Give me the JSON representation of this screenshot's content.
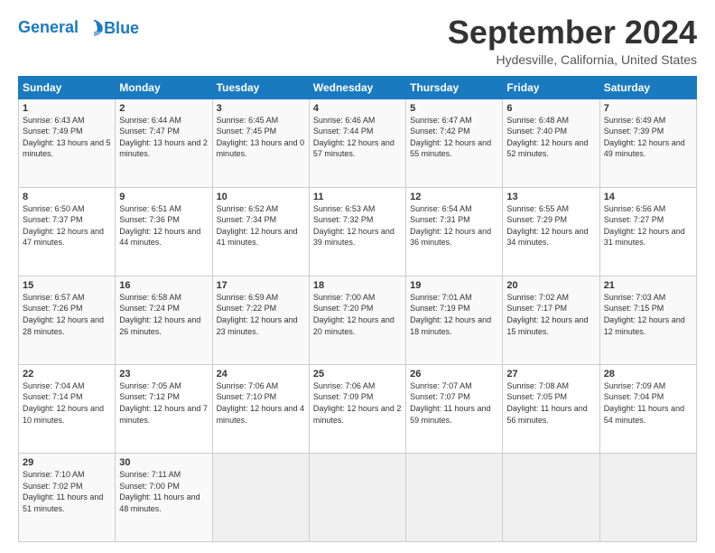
{
  "header": {
    "logo_line1": "General",
    "logo_line2": "Blue",
    "month_year": "September 2024",
    "location": "Hydesville, California, United States"
  },
  "weekdays": [
    "Sunday",
    "Monday",
    "Tuesday",
    "Wednesday",
    "Thursday",
    "Friday",
    "Saturday"
  ],
  "weeks": [
    [
      {
        "day": "1",
        "sunrise": "6:43 AM",
        "sunset": "7:49 PM",
        "daylight": "13 hours and 5 minutes."
      },
      {
        "day": "2",
        "sunrise": "6:44 AM",
        "sunset": "7:47 PM",
        "daylight": "13 hours and 2 minutes."
      },
      {
        "day": "3",
        "sunrise": "6:45 AM",
        "sunset": "7:45 PM",
        "daylight": "13 hours and 0 minutes."
      },
      {
        "day": "4",
        "sunrise": "6:46 AM",
        "sunset": "7:44 PM",
        "daylight": "12 hours and 57 minutes."
      },
      {
        "day": "5",
        "sunrise": "6:47 AM",
        "sunset": "7:42 PM",
        "daylight": "12 hours and 55 minutes."
      },
      {
        "day": "6",
        "sunrise": "6:48 AM",
        "sunset": "7:40 PM",
        "daylight": "12 hours and 52 minutes."
      },
      {
        "day": "7",
        "sunrise": "6:49 AM",
        "sunset": "7:39 PM",
        "daylight": "12 hours and 49 minutes."
      }
    ],
    [
      {
        "day": "8",
        "sunrise": "6:50 AM",
        "sunset": "7:37 PM",
        "daylight": "12 hours and 47 minutes."
      },
      {
        "day": "9",
        "sunrise": "6:51 AM",
        "sunset": "7:36 PM",
        "daylight": "12 hours and 44 minutes."
      },
      {
        "day": "10",
        "sunrise": "6:52 AM",
        "sunset": "7:34 PM",
        "daylight": "12 hours and 41 minutes."
      },
      {
        "day": "11",
        "sunrise": "6:53 AM",
        "sunset": "7:32 PM",
        "daylight": "12 hours and 39 minutes."
      },
      {
        "day": "12",
        "sunrise": "6:54 AM",
        "sunset": "7:31 PM",
        "daylight": "12 hours and 36 minutes."
      },
      {
        "day": "13",
        "sunrise": "6:55 AM",
        "sunset": "7:29 PM",
        "daylight": "12 hours and 34 minutes."
      },
      {
        "day": "14",
        "sunrise": "6:56 AM",
        "sunset": "7:27 PM",
        "daylight": "12 hours and 31 minutes."
      }
    ],
    [
      {
        "day": "15",
        "sunrise": "6:57 AM",
        "sunset": "7:26 PM",
        "daylight": "12 hours and 28 minutes."
      },
      {
        "day": "16",
        "sunrise": "6:58 AM",
        "sunset": "7:24 PM",
        "daylight": "12 hours and 26 minutes."
      },
      {
        "day": "17",
        "sunrise": "6:59 AM",
        "sunset": "7:22 PM",
        "daylight": "12 hours and 23 minutes."
      },
      {
        "day": "18",
        "sunrise": "7:00 AM",
        "sunset": "7:20 PM",
        "daylight": "12 hours and 20 minutes."
      },
      {
        "day": "19",
        "sunrise": "7:01 AM",
        "sunset": "7:19 PM",
        "daylight": "12 hours and 18 minutes."
      },
      {
        "day": "20",
        "sunrise": "7:02 AM",
        "sunset": "7:17 PM",
        "daylight": "12 hours and 15 minutes."
      },
      {
        "day": "21",
        "sunrise": "7:03 AM",
        "sunset": "7:15 PM",
        "daylight": "12 hours and 12 minutes."
      }
    ],
    [
      {
        "day": "22",
        "sunrise": "7:04 AM",
        "sunset": "7:14 PM",
        "daylight": "12 hours and 10 minutes."
      },
      {
        "day": "23",
        "sunrise": "7:05 AM",
        "sunset": "7:12 PM",
        "daylight": "12 hours and 7 minutes."
      },
      {
        "day": "24",
        "sunrise": "7:06 AM",
        "sunset": "7:10 PM",
        "daylight": "12 hours and 4 minutes."
      },
      {
        "day": "25",
        "sunrise": "7:06 AM",
        "sunset": "7:09 PM",
        "daylight": "12 hours and 2 minutes."
      },
      {
        "day": "26",
        "sunrise": "7:07 AM",
        "sunset": "7:07 PM",
        "daylight": "11 hours and 59 minutes."
      },
      {
        "day": "27",
        "sunrise": "7:08 AM",
        "sunset": "7:05 PM",
        "daylight": "11 hours and 56 minutes."
      },
      {
        "day": "28",
        "sunrise": "7:09 AM",
        "sunset": "7:04 PM",
        "daylight": "11 hours and 54 minutes."
      }
    ],
    [
      {
        "day": "29",
        "sunrise": "7:10 AM",
        "sunset": "7:02 PM",
        "daylight": "11 hours and 51 minutes."
      },
      {
        "day": "30",
        "sunrise": "7:11 AM",
        "sunset": "7:00 PM",
        "daylight": "11 hours and 48 minutes."
      },
      null,
      null,
      null,
      null,
      null
    ]
  ]
}
